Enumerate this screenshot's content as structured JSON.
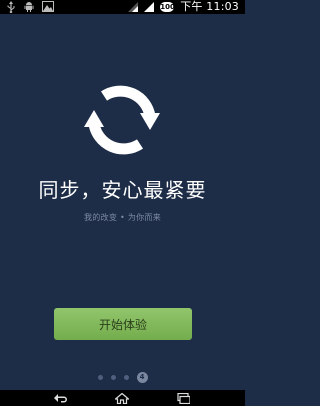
{
  "status_bar": {
    "left_icons": [
      "usb-icon",
      "android-icon",
      "image-notification-icon"
    ],
    "right_icons": [
      "wifi-signal-icon",
      "cell-signal-icon"
    ],
    "battery_label": "100",
    "time": "下午 11:03"
  },
  "main": {
    "hero_icon": "sync-arrows-icon",
    "headline": "同步，安心最紧要",
    "subline": "我的改变 • 为你而来",
    "start_button_label": "开始体验"
  },
  "pager": {
    "pages": 4,
    "current_page": 4,
    "active_label": "4"
  },
  "nav_bar": {
    "buttons": [
      "back-icon",
      "home-icon",
      "recent-apps-icon"
    ]
  },
  "colors": {
    "background": "#1d2c47",
    "button": "#82b95c",
    "headline": "#ffffff",
    "subline": "#7e8ba5"
  }
}
